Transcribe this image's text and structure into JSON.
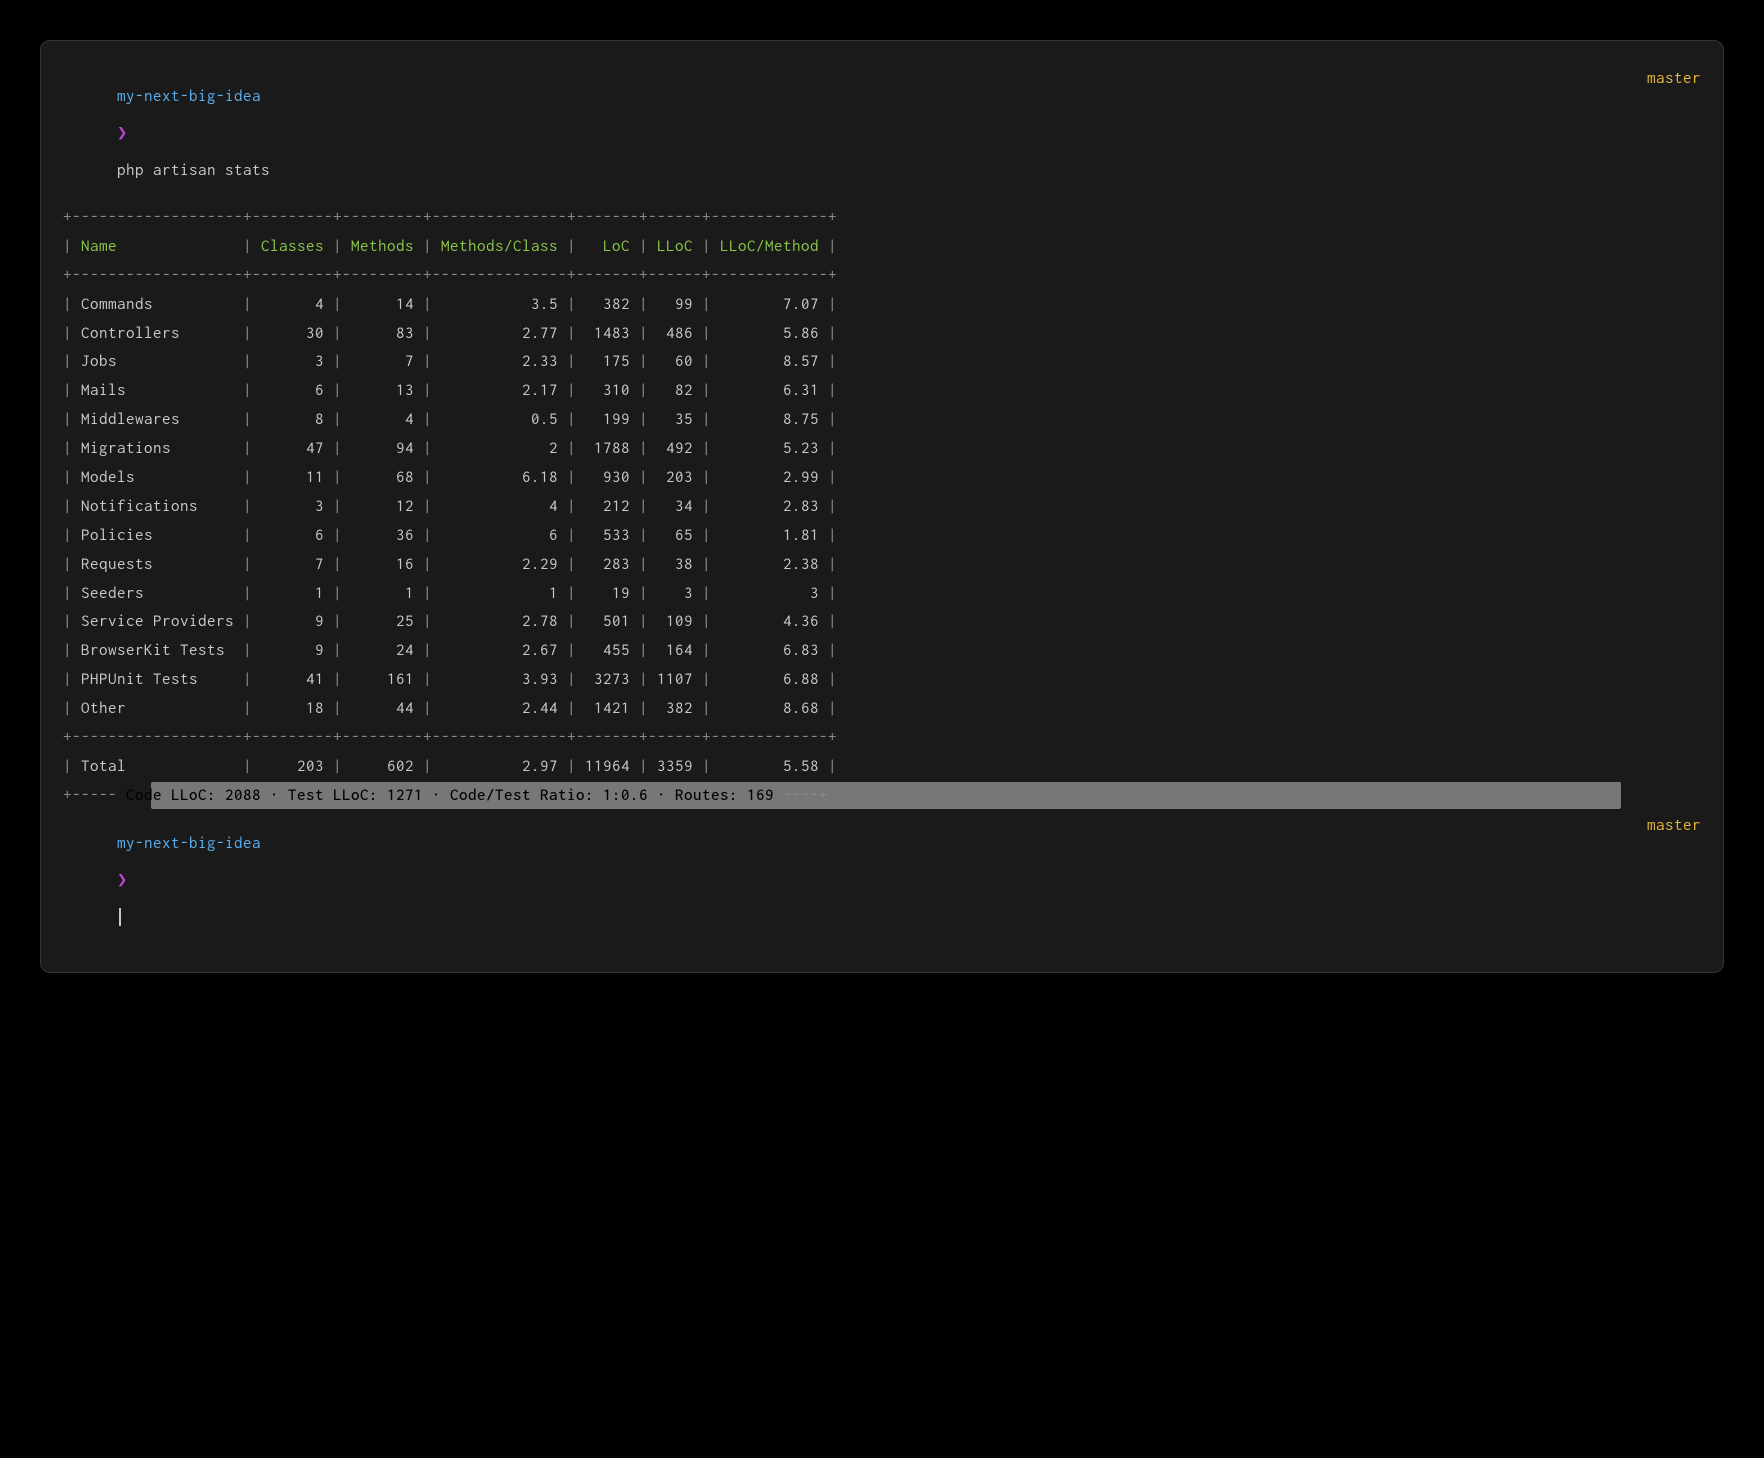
{
  "prompt": {
    "path": "my-next-big-idea",
    "chevron": "❯",
    "command": "php artisan stats",
    "branch": "master"
  },
  "table": {
    "headers": [
      "Name",
      "Classes",
      "Methods",
      "Methods/Class",
      "LoC",
      "LLoC",
      "LLoC/Method"
    ],
    "rows": [
      {
        "name": "Commands",
        "classes": "4",
        "methods": "14",
        "mpc": "3.5",
        "loc": "382",
        "lloc": "99",
        "lpm": "7.07"
      },
      {
        "name": "Controllers",
        "classes": "30",
        "methods": "83",
        "mpc": "2.77",
        "loc": "1483",
        "lloc": "486",
        "lpm": "5.86"
      },
      {
        "name": "Jobs",
        "classes": "3",
        "methods": "7",
        "mpc": "2.33",
        "loc": "175",
        "lloc": "60",
        "lpm": "8.57"
      },
      {
        "name": "Mails",
        "classes": "6",
        "methods": "13",
        "mpc": "2.17",
        "loc": "310",
        "lloc": "82",
        "lpm": "6.31"
      },
      {
        "name": "Middlewares",
        "classes": "8",
        "methods": "4",
        "mpc": "0.5",
        "loc": "199",
        "lloc": "35",
        "lpm": "8.75"
      },
      {
        "name": "Migrations",
        "classes": "47",
        "methods": "94",
        "mpc": "2",
        "loc": "1788",
        "lloc": "492",
        "lpm": "5.23"
      },
      {
        "name": "Models",
        "classes": "11",
        "methods": "68",
        "mpc": "6.18",
        "loc": "930",
        "lloc": "203",
        "lpm": "2.99"
      },
      {
        "name": "Notifications",
        "classes": "3",
        "methods": "12",
        "mpc": "4",
        "loc": "212",
        "lloc": "34",
        "lpm": "2.83"
      },
      {
        "name": "Policies",
        "classes": "6",
        "methods": "36",
        "mpc": "6",
        "loc": "533",
        "lloc": "65",
        "lpm": "1.81"
      },
      {
        "name": "Requests",
        "classes": "7",
        "methods": "16",
        "mpc": "2.29",
        "loc": "283",
        "lloc": "38",
        "lpm": "2.38"
      },
      {
        "name": "Seeders",
        "classes": "1",
        "methods": "1",
        "mpc": "1",
        "loc": "19",
        "lloc": "3",
        "lpm": "3"
      },
      {
        "name": "Service Providers",
        "classes": "9",
        "methods": "25",
        "mpc": "2.78",
        "loc": "501",
        "lloc": "109",
        "lpm": "4.36"
      },
      {
        "name": "BrowserKit Tests",
        "classes": "9",
        "methods": "24",
        "mpc": "2.67",
        "loc": "455",
        "lloc": "164",
        "lpm": "6.83"
      },
      {
        "name": "PHPUnit Tests",
        "classes": "41",
        "methods": "161",
        "mpc": "3.93",
        "loc": "3273",
        "lloc": "1107",
        "lpm": "6.88"
      },
      {
        "name": "Other",
        "classes": "18",
        "methods": "44",
        "mpc": "2.44",
        "loc": "1421",
        "lloc": "382",
        "lpm": "8.68"
      }
    ],
    "total": {
      "name": "Total",
      "classes": "203",
      "methods": "602",
      "mpc": "2.97",
      "loc": "11964",
      "lloc": "3359",
      "lpm": "5.58"
    },
    "widths": {
      "name": 19,
      "classes": 9,
      "methods": 9,
      "mpc": 15,
      "loc": 7,
      "lloc": 6,
      "lpm": 13
    }
  },
  "summary": {
    "code_lloc": "2088",
    "test_lloc": "1271",
    "ratio": "1:0.6",
    "routes": "169"
  }
}
